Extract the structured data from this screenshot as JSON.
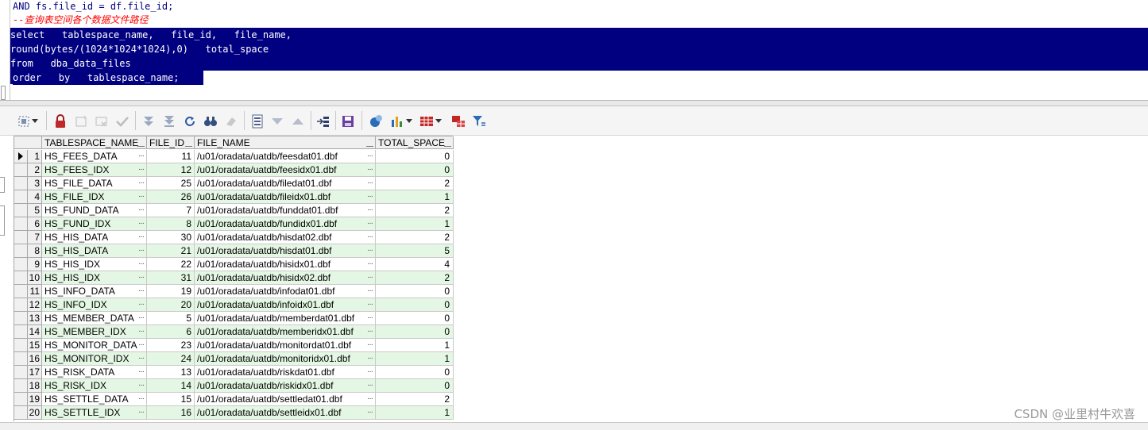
{
  "editor": {
    "line_prev": "AND fs.file_id = df.file_id;",
    "comment": "--查询表空间各个数据文件路径",
    "selected_lines": [
      "select   tablespace_name,   file_id,   file_name,",
      "round(bytes/(1024*1024*1024),0)   total_space",
      "from   dba_data_files",
      "order   by   tablespace_name;"
    ]
  },
  "toolbar": {
    "buttons": [
      "select-mode-icon",
      "lock-icon",
      "new-record-icon",
      "delete-record-icon",
      "post-record-icon",
      "fetch-next-icon",
      "fetch-last-icon",
      "refresh-icon",
      "find-icon",
      "clear-icon",
      "single-record-icon",
      "query-by-example-icon",
      "previous-icon",
      "export-icon",
      "save-icon",
      "link-icon",
      "chart-icon",
      "grid-layout-icon",
      "compare-icon",
      "filter-icon"
    ]
  },
  "grid": {
    "columns": [
      "TABLESPACE_NAME",
      "FILE_ID",
      "FILE_NAME",
      "TOTAL_SPACE"
    ],
    "rows": [
      {
        "n": "1",
        "ts": "HS_FEES_DATA",
        "id": "11",
        "fn": "/u01/oradata/uatdb/feesdat01.dbf",
        "tot": "0"
      },
      {
        "n": "2",
        "ts": "HS_FEES_IDX",
        "id": "12",
        "fn": "/u01/oradata/uatdb/feesidx01.dbf",
        "tot": "0"
      },
      {
        "n": "3",
        "ts": "HS_FILE_DATA",
        "id": "25",
        "fn": "/u01/oradata/uatdb/filedat01.dbf",
        "tot": "2"
      },
      {
        "n": "4",
        "ts": "HS_FILE_IDX",
        "id": "26",
        "fn": "/u01/oradata/uatdb/fileidx01.dbf",
        "tot": "1"
      },
      {
        "n": "5",
        "ts": "HS_FUND_DATA",
        "id": "7",
        "fn": "/u01/oradata/uatdb/funddat01.dbf",
        "tot": "2"
      },
      {
        "n": "6",
        "ts": "HS_FUND_IDX",
        "id": "8",
        "fn": "/u01/oradata/uatdb/fundidx01.dbf",
        "tot": "1"
      },
      {
        "n": "7",
        "ts": "HS_HIS_DATA",
        "id": "30",
        "fn": "/u01/oradata/uatdb/hisdat02.dbf",
        "tot": "2"
      },
      {
        "n": "8",
        "ts": "HS_HIS_DATA",
        "id": "21",
        "fn": "/u01/oradata/uatdb/hisdat01.dbf",
        "tot": "5"
      },
      {
        "n": "9",
        "ts": "HS_HIS_IDX",
        "id": "22",
        "fn": "/u01/oradata/uatdb/hisidx01.dbf",
        "tot": "4"
      },
      {
        "n": "10",
        "ts": "HS_HIS_IDX",
        "id": "31",
        "fn": "/u01/oradata/uatdb/hisidx02.dbf",
        "tot": "2"
      },
      {
        "n": "11",
        "ts": "HS_INFO_DATA",
        "id": "19",
        "fn": "/u01/oradata/uatdb/infodat01.dbf",
        "tot": "0"
      },
      {
        "n": "12",
        "ts": "HS_INFO_IDX",
        "id": "20",
        "fn": "/u01/oradata/uatdb/infoidx01.dbf",
        "tot": "0"
      },
      {
        "n": "13",
        "ts": "HS_MEMBER_DATA",
        "id": "5",
        "fn": "/u01/oradata/uatdb/memberdat01.dbf",
        "tot": "0"
      },
      {
        "n": "14",
        "ts": "HS_MEMBER_IDX",
        "id": "6",
        "fn": "/u01/oradata/uatdb/memberidx01.dbf",
        "tot": "0"
      },
      {
        "n": "15",
        "ts": "HS_MONITOR_DATA",
        "id": "23",
        "fn": "/u01/oradata/uatdb/monitordat01.dbf",
        "tot": "1"
      },
      {
        "n": "16",
        "ts": "HS_MONITOR_IDX",
        "id": "24",
        "fn": "/u01/oradata/uatdb/monitoridx01.dbf",
        "tot": "1"
      },
      {
        "n": "17",
        "ts": "HS_RISK_DATA",
        "id": "13",
        "fn": "/u01/oradata/uatdb/riskdat01.dbf",
        "tot": "0"
      },
      {
        "n": "18",
        "ts": "HS_RISK_IDX",
        "id": "14",
        "fn": "/u01/oradata/uatdb/riskidx01.dbf",
        "tot": "0"
      },
      {
        "n": "19",
        "ts": "HS_SETTLE_DATA",
        "id": "15",
        "fn": "/u01/oradata/uatdb/settledat01.dbf",
        "tot": "2"
      },
      {
        "n": "20",
        "ts": "HS_SETTLE_IDX",
        "id": "16",
        "fn": "/u01/oradata/uatdb/settleidx01.dbf",
        "tot": "1"
      }
    ],
    "cell_button": "···"
  },
  "watermark": "CSDN @业里村牛欢喜",
  "colors": {
    "selection": "#000080",
    "comment": "#ff0000",
    "row_alt": "#e4f7e4"
  }
}
